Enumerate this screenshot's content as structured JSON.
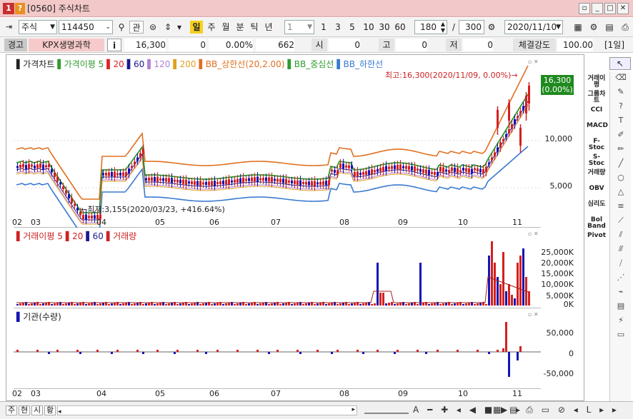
{
  "window": {
    "num": "1",
    "qmark": "?",
    "title": "[0560] 주식차트"
  },
  "toolbar": {
    "market": "주식",
    "code": "114450",
    "btn_gwan": "관",
    "periods": [
      "일",
      "주",
      "월",
      "분",
      "틱",
      "년"
    ],
    "interval_select": "1",
    "intervals": [
      "1",
      "3",
      "5",
      "10",
      "30",
      "60"
    ],
    "count": "180",
    "slash": "/",
    "total": "300",
    "date": "2020/11/10"
  },
  "info": {
    "warn": "경고",
    "name": "KPX생명과학",
    "i": "i",
    "price": "16,300",
    "change": "0",
    "pct": "0.00%",
    "volume": "662",
    "open_label": "시",
    "open": "0",
    "high_label": "고",
    "high": "0",
    "low_label": "저",
    "low": "0",
    "strength_label": "체결강도",
    "strength": "100.00",
    "period_tag": "[1일]"
  },
  "price_panel": {
    "legend": [
      {
        "text": "가격차트",
        "color": "#222222"
      },
      {
        "text": "가격이평 5",
        "color": "#2e9b2e"
      },
      {
        "text": "20",
        "color": "#d22"
      },
      {
        "text": "60",
        "color": "#1a1a8c"
      },
      {
        "text": "120",
        "color": "#b080d0"
      },
      {
        "text": "200",
        "color": "#e0a020"
      },
      {
        "text": "BB_상한선(20,2.00)",
        "color": "#e07020"
      },
      {
        "text": "BB_중심선",
        "color": "#2e9b2e"
      },
      {
        "text": "BB_하한선",
        "color": "#3a7ad0"
      }
    ],
    "high_note": "최고:16,300(2020/11/09, 0.00%)→",
    "low_note": "←최저:3,155(2020/03/23, +416.64%)",
    "cur_price": "16,300",
    "cur_pct": "(0.00%)",
    "y_ticks": [
      "10,000",
      "5,000"
    ]
  },
  "volume_panel": {
    "legend": [
      {
        "text": "거래이평 5",
        "color": "#c22"
      },
      {
        "text": "20",
        "color": "#c22"
      },
      {
        "text": "60",
        "color": "#1a1a8c"
      },
      {
        "text": "거래량",
        "color": "#c22"
      }
    ],
    "y_ticks": [
      "25,000K",
      "20,000K",
      "15,000K",
      "10,000K",
      "5,000K",
      "0K"
    ]
  },
  "inst_panel": {
    "legend": "기관(수량)",
    "y_ticks": [
      "50,000",
      "0",
      "-50,000"
    ]
  },
  "x_ticks": [
    "02",
    "03",
    "04",
    "05",
    "06",
    "07",
    "08",
    "09",
    "10",
    "11"
  ],
  "sidebar": [
    "거래이평",
    "그룹차트",
    "CCI",
    "MACD",
    "F-Stoc",
    "S-Stoc",
    "거래량",
    "OBV",
    "심리도",
    "Bol Band",
    "Pivot"
  ],
  "bottom": {
    "tabs": [
      "주",
      "현",
      "시",
      "황"
    ]
  },
  "colors": {
    "up": "#d42020",
    "down": "#1414b4",
    "title_bg": "#f3c8c8",
    "cur_box": "#1f8a1f"
  }
}
